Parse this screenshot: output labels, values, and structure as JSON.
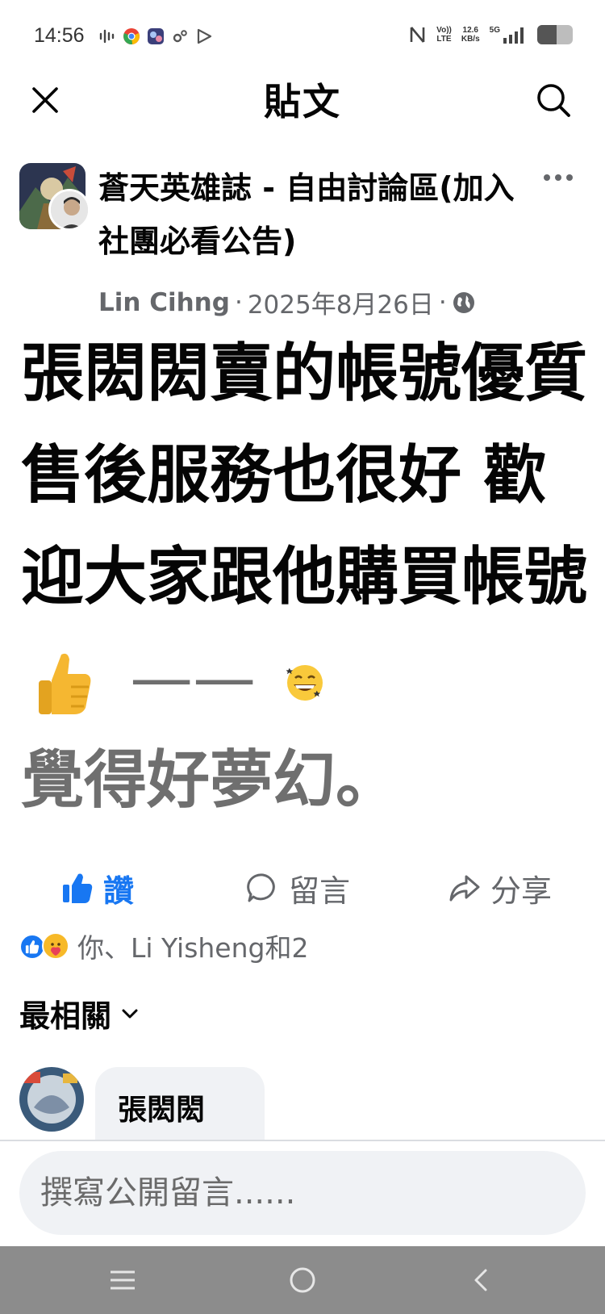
{
  "status_bar": {
    "time": "14:56",
    "network_speed_value": "12.6",
    "network_speed_unit": "KB/s",
    "volte_top": "Vo))",
    "volte_bottom": "LTE",
    "network_type": "5G",
    "battery_level": 0.55
  },
  "header": {
    "title": "貼文",
    "close_icon": "close-icon",
    "search_icon": "search-icon"
  },
  "post": {
    "group_name": "蒼天英雄誌 - 自由討論區(加入社團必看公告)",
    "author": "Lin Cihng",
    "separator1": "·",
    "date": "2025年8月26日",
    "separator2": "·",
    "privacy_icon": "globe-icon",
    "body_main": "張閎閎賣的帳號優質 售後服務也很好 歡迎大家跟他購買帳號",
    "body_dash": "——",
    "body_gray": "覺得好夢幻。"
  },
  "actions": {
    "like_label": "讚",
    "comment_label": "留言",
    "share_label": "分享"
  },
  "reactions": {
    "summary": "你、Li Yisheng和2"
  },
  "sort": {
    "label": "最相關"
  },
  "comments": [
    {
      "author": "張閎閎"
    }
  ],
  "composer": {
    "placeholder": "撰寫公開留言......"
  },
  "colors": {
    "facebook_blue": "#1877f2",
    "secondary_text": "#65676b",
    "bubble_bg": "#f0f2f5",
    "nav_bar": "#8c8c8c"
  }
}
